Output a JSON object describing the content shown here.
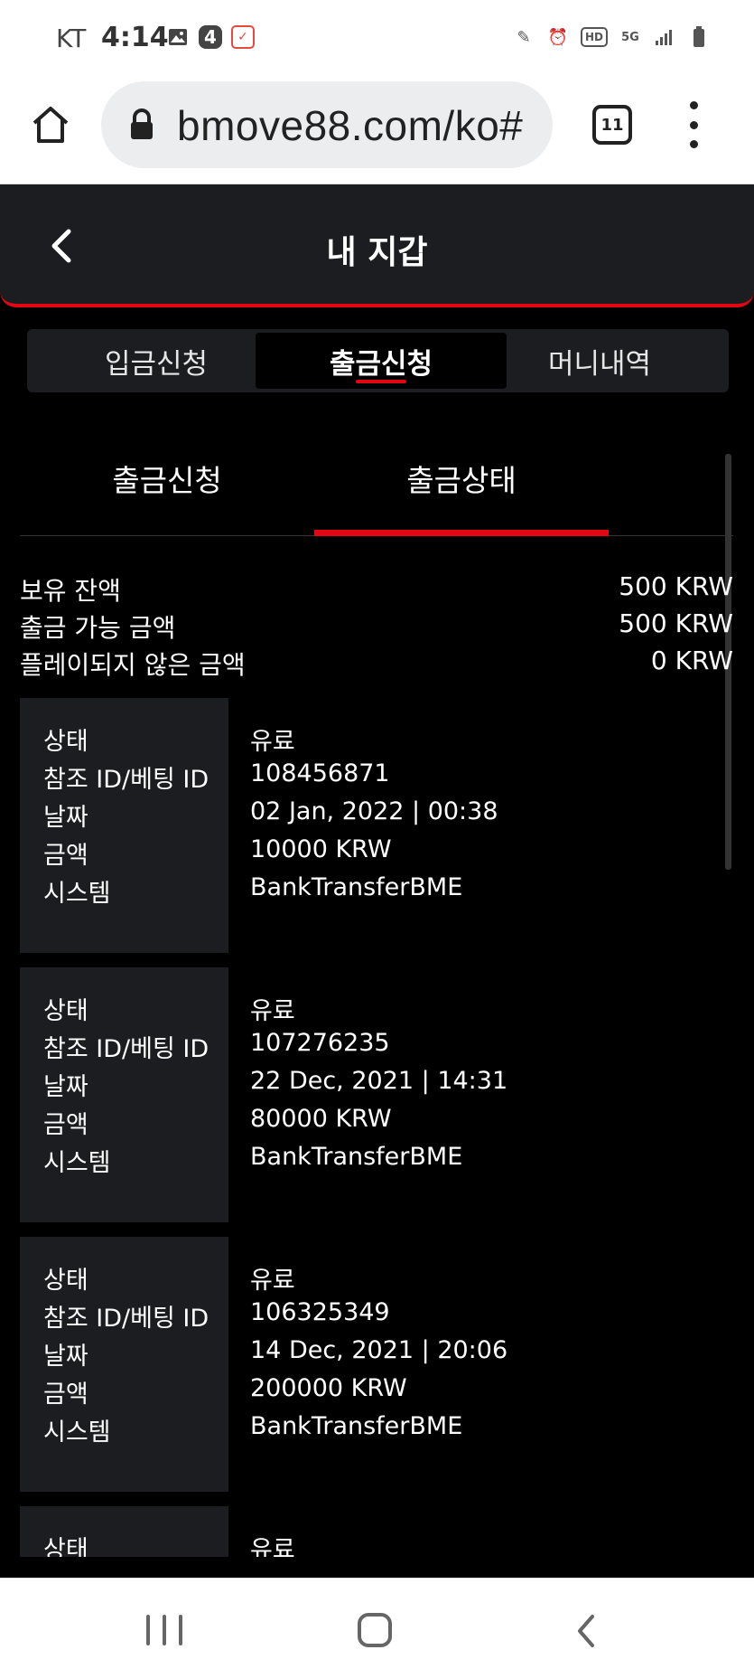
{
  "status_bar": {
    "carrier": "KT",
    "time": "4:14",
    "notification_badge": "4"
  },
  "browser": {
    "url": "bmove88.com/ko#",
    "tab_count": "11"
  },
  "header": {
    "title": "내 지갑"
  },
  "main_tabs": [
    {
      "label": "입금신청",
      "active": false
    },
    {
      "label": "출금신청",
      "active": true
    },
    {
      "label": "머니내역",
      "active": false
    }
  ],
  "sub_tabs": [
    {
      "label": "출금신청",
      "active": false
    },
    {
      "label": "출금상태",
      "active": true
    }
  ],
  "balance": [
    {
      "label": "보유 잔액",
      "value": "500 KRW"
    },
    {
      "label": "출금 가능 금액",
      "value": "500 KRW"
    },
    {
      "label": "플레이되지 않은 금액",
      "value": "0 KRW"
    }
  ],
  "tx_labels": {
    "status": "상태",
    "ref_id": "참조 ID/베팅 ID",
    "date": "날짜",
    "amount": "금액",
    "system": "시스템"
  },
  "transactions": [
    {
      "status": "유료",
      "ref_id": "108456871",
      "date": "02 Jan, 2022 | 00:38",
      "amount": "10000 KRW",
      "system": "BankTransferBME"
    },
    {
      "status": "유료",
      "ref_id": "107276235",
      "date": "22 Dec, 2021 | 14:31",
      "amount": "80000 KRW",
      "system": "BankTransferBME"
    },
    {
      "status": "유료",
      "ref_id": "106325349",
      "date": "14 Dec, 2021 | 20:06",
      "amount": "200000 KRW",
      "system": "BankTransferBME"
    },
    {
      "status": "유료",
      "ref_id": "",
      "date": "",
      "amount": "",
      "system": ""
    }
  ],
  "colors": {
    "accent": "#e30613",
    "panel": "#1c1d21",
    "background": "#000000"
  }
}
